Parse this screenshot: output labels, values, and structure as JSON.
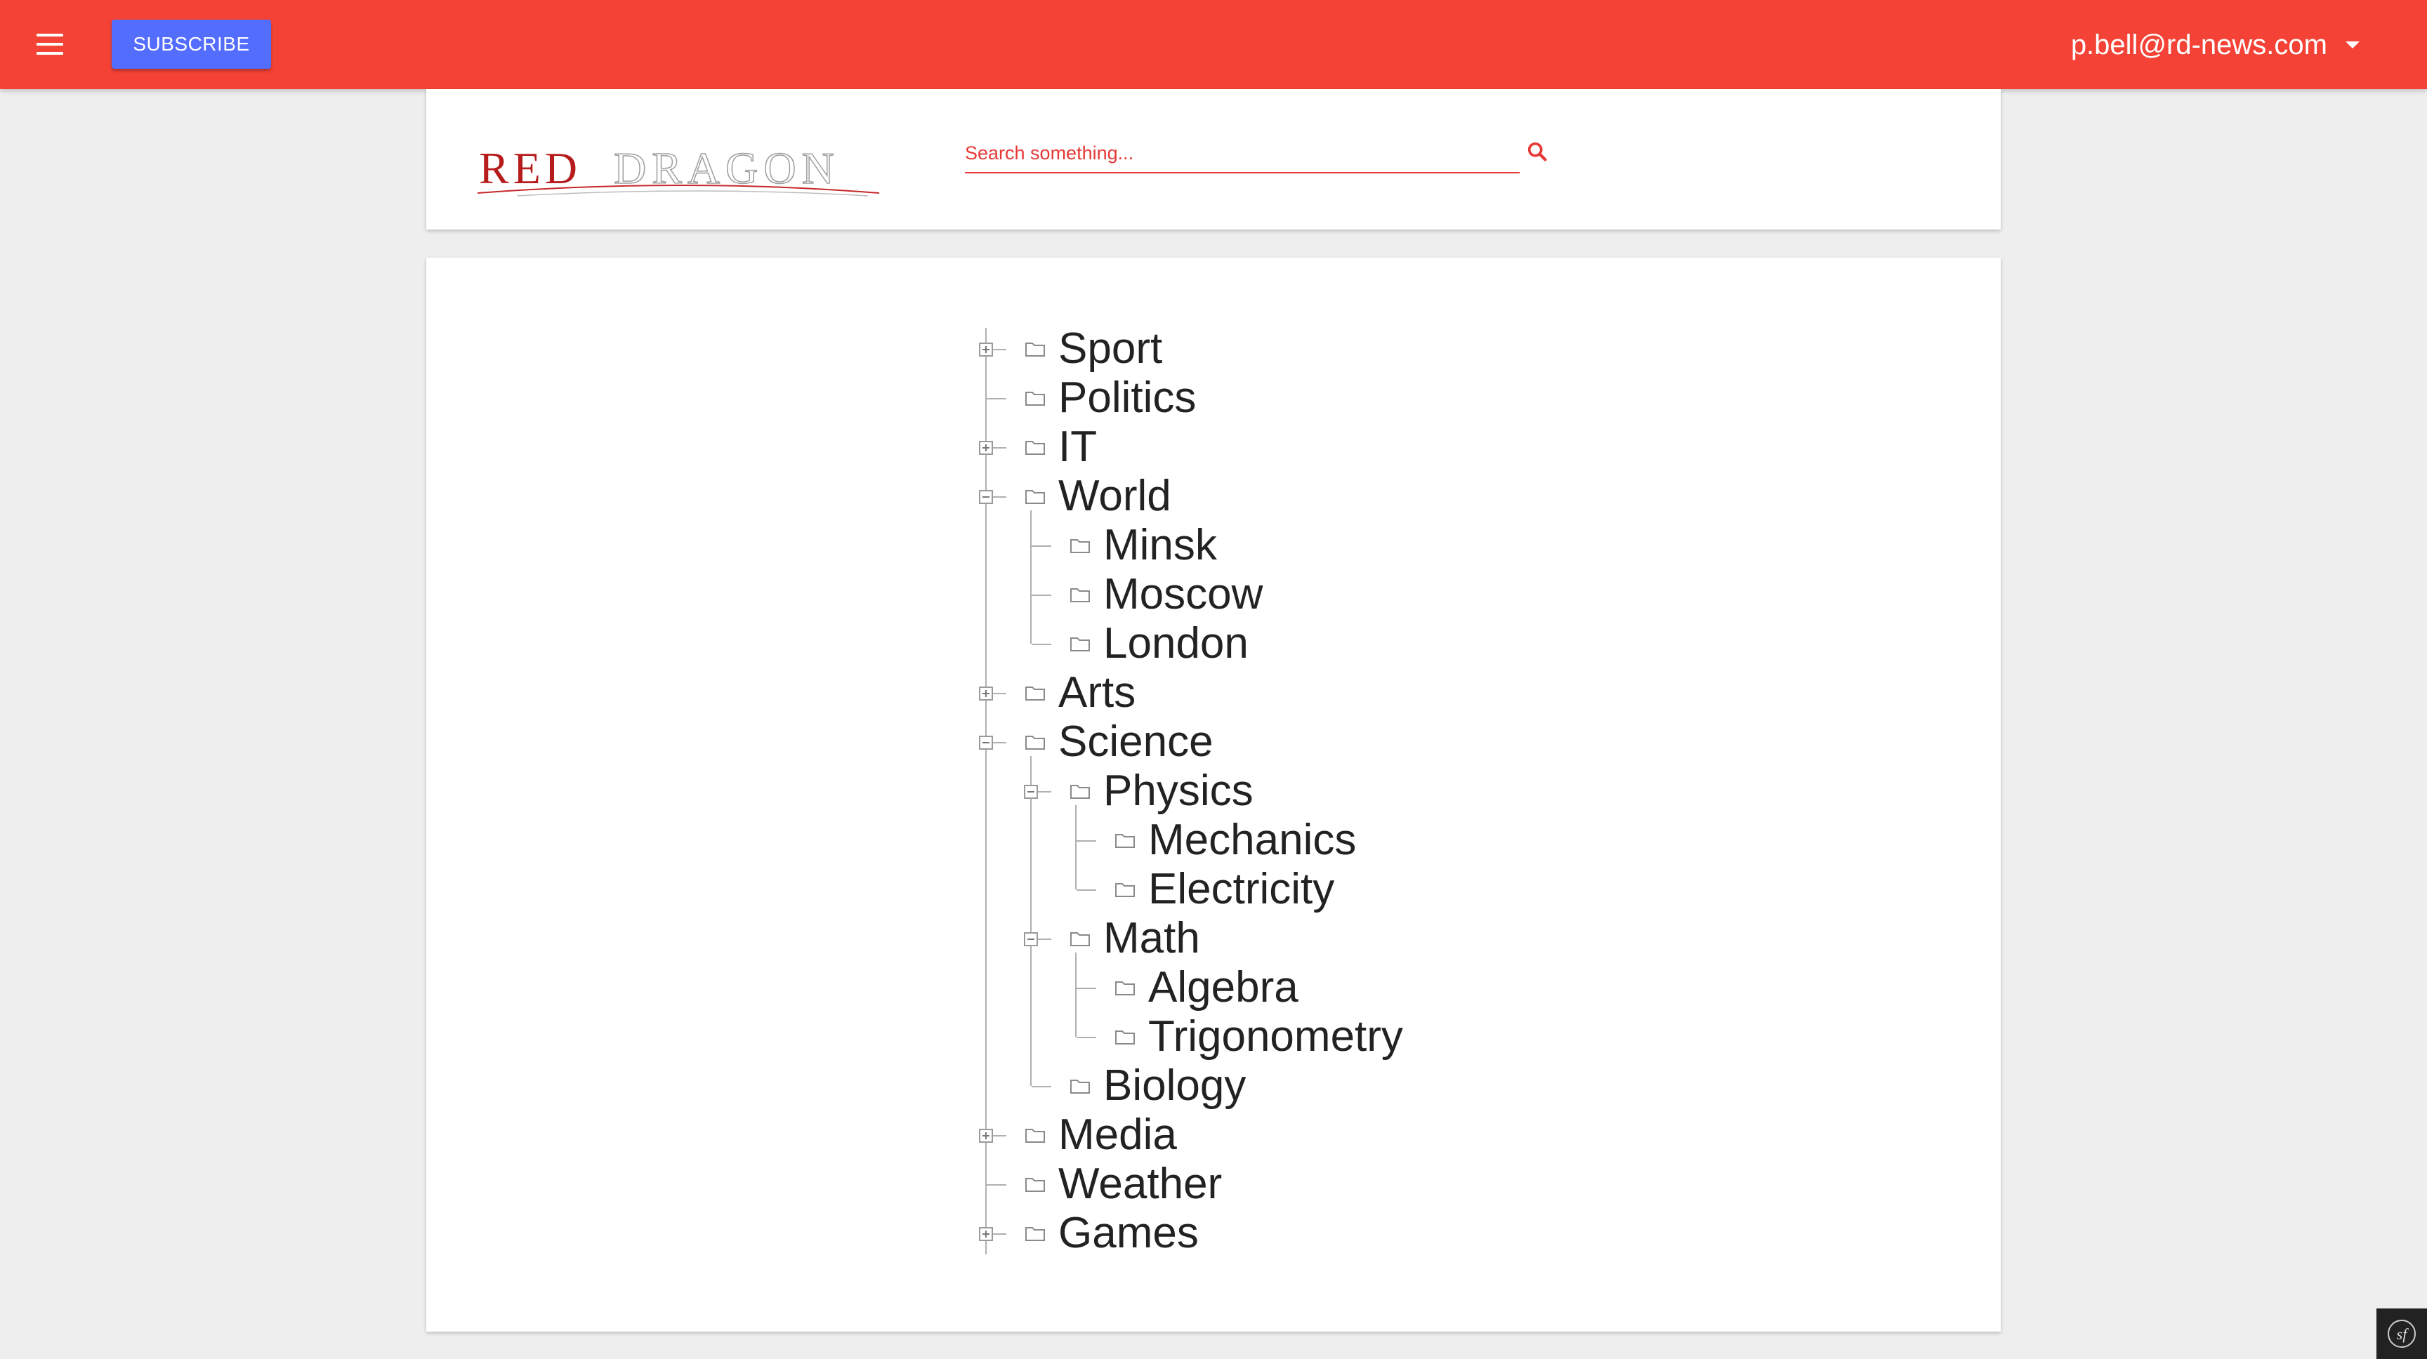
{
  "topbar": {
    "subscribe_label": "SUBSCRIBE",
    "user_email": "p.bell@rd-news.com",
    "menu_icon": "hamburger-menu-icon",
    "color": "#f44336",
    "button_color": "#536dfe"
  },
  "header": {
    "logo_text_red": "RED",
    "logo_text_outline": "DRAGON",
    "search": {
      "placeholder": "Search something...",
      "value": ""
    }
  },
  "tree": {
    "nodes": [
      {
        "label": "Sport",
        "level": 0,
        "toggle": "plus"
      },
      {
        "label": "Politics",
        "level": 0,
        "toggle": "none"
      },
      {
        "label": "IT",
        "level": 0,
        "toggle": "plus"
      },
      {
        "label": "World",
        "level": 0,
        "toggle": "minus"
      },
      {
        "label": "Minsk",
        "level": 1,
        "toggle": "none"
      },
      {
        "label": "Moscow",
        "level": 1,
        "toggle": "none"
      },
      {
        "label": "London",
        "level": 1,
        "toggle": "none"
      },
      {
        "label": "Arts",
        "level": 0,
        "toggle": "plus"
      },
      {
        "label": "Science",
        "level": 0,
        "toggle": "minus"
      },
      {
        "label": "Physics",
        "level": 1,
        "toggle": "minus"
      },
      {
        "label": "Mechanics",
        "level": 2,
        "toggle": "none"
      },
      {
        "label": "Electricity",
        "level": 2,
        "toggle": "none"
      },
      {
        "label": "Math",
        "level": 1,
        "toggle": "minus"
      },
      {
        "label": "Algebra",
        "level": 2,
        "toggle": "none"
      },
      {
        "label": "Trigonometry",
        "level": 2,
        "toggle": "none"
      },
      {
        "label": "Biology",
        "level": 1,
        "toggle": "none"
      },
      {
        "label": "Media",
        "level": 0,
        "toggle": "plus"
      },
      {
        "label": "Weather",
        "level": 0,
        "toggle": "none"
      },
      {
        "label": "Games",
        "level": 0,
        "toggle": "plus"
      }
    ]
  },
  "footer": {
    "badge_icon": "symfony-icon"
  }
}
